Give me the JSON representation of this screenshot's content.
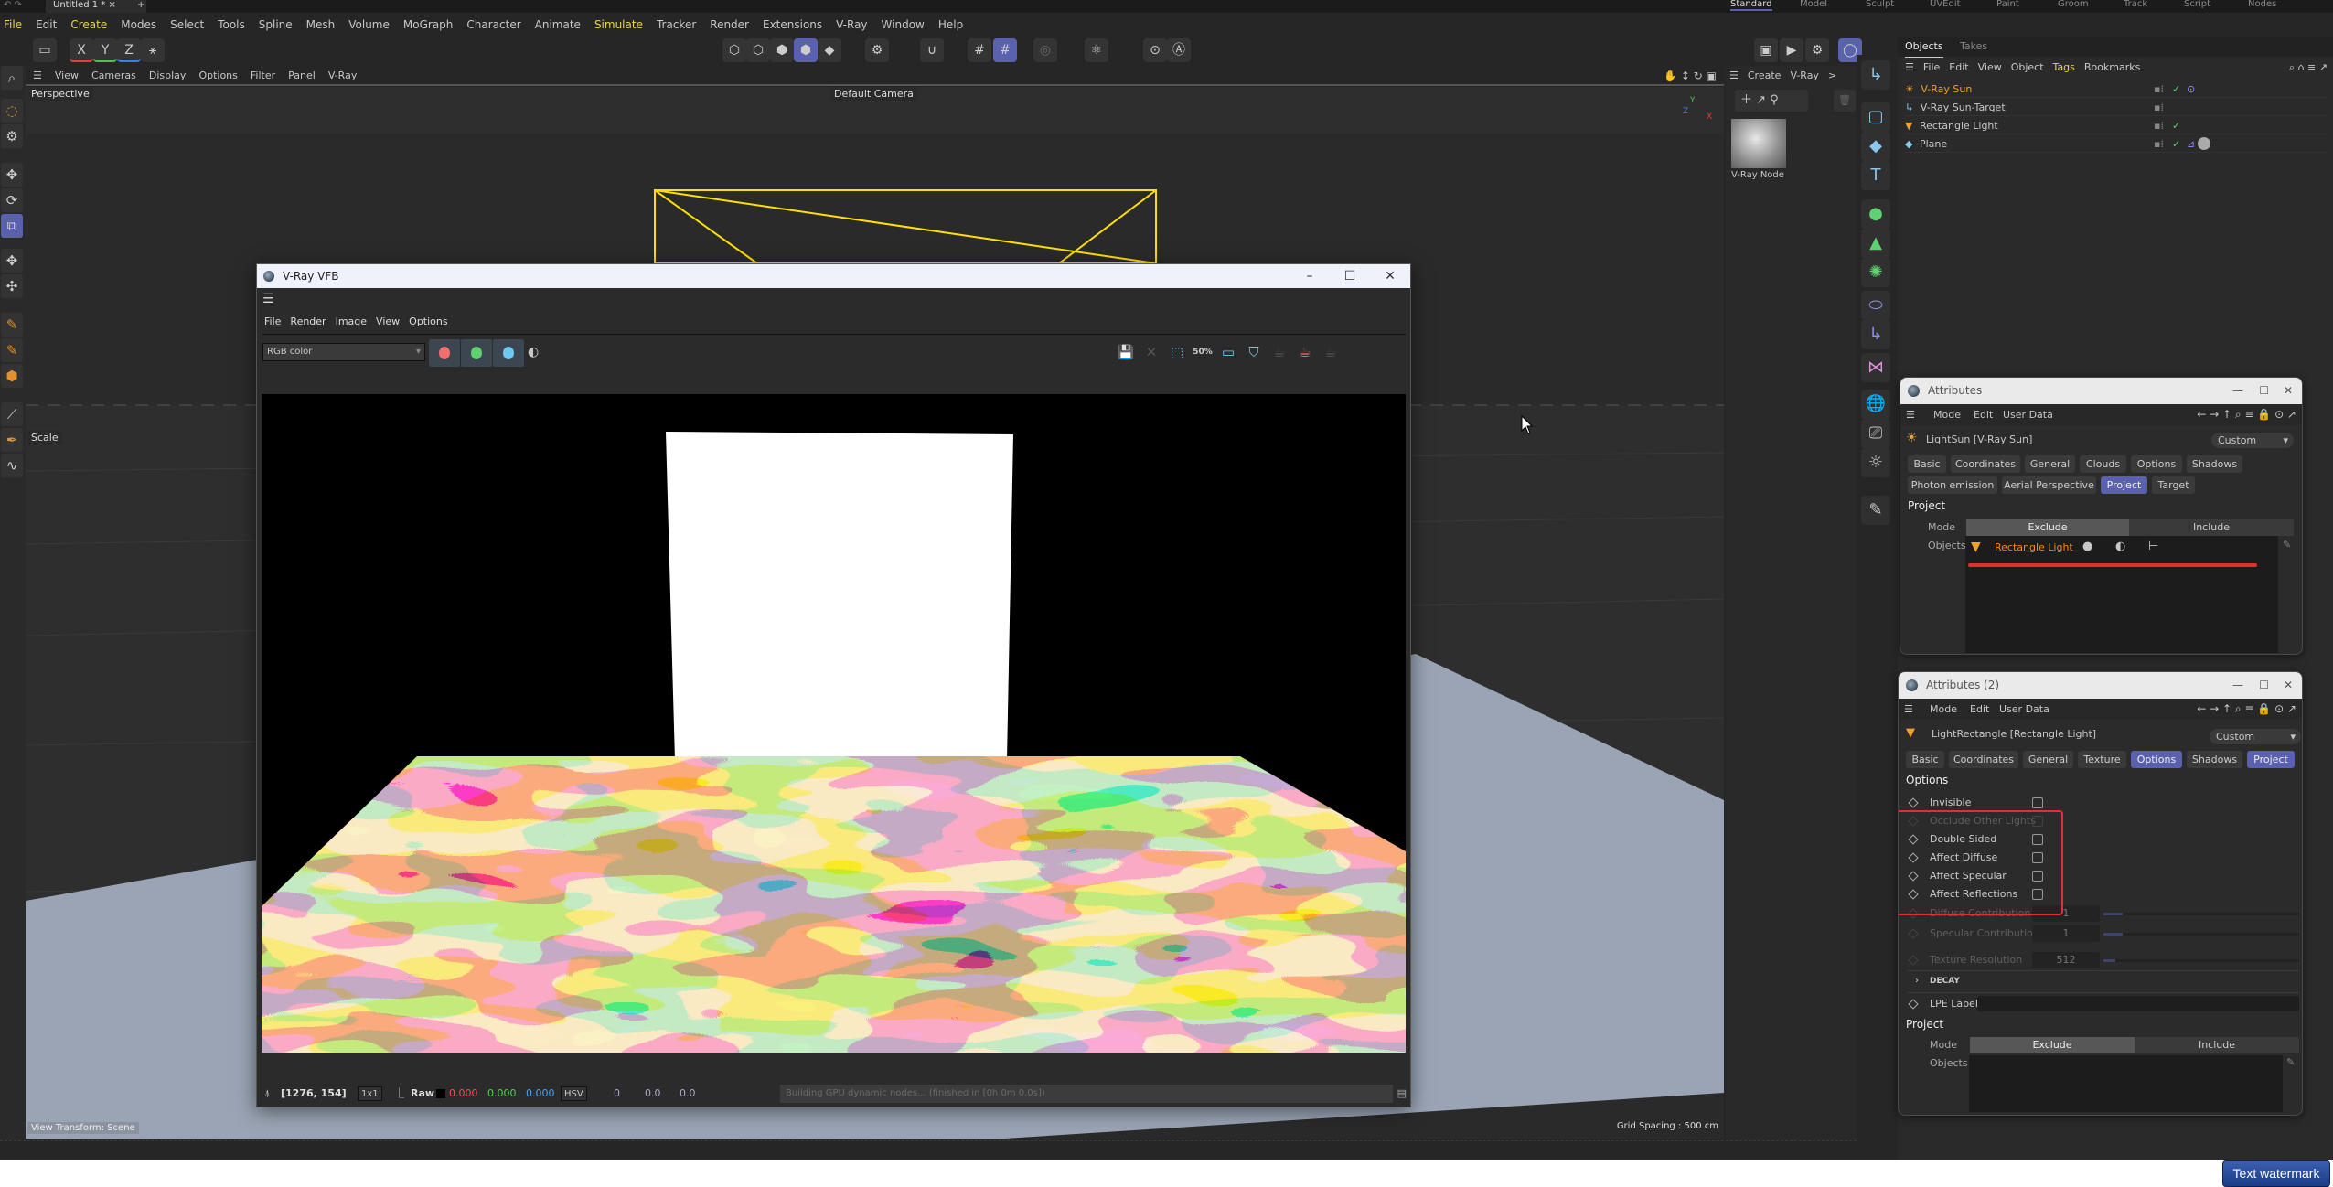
{
  "app": {
    "doc_tab": "Untitled 1 *",
    "layout_tabs": [
      "Standard",
      "Model",
      "Sculpt",
      "UVEdit",
      "Paint",
      "Groom",
      "Track",
      "Script",
      "Nodes"
    ],
    "active_layout": "Standard",
    "menu": [
      "File",
      "Edit",
      "Create",
      "Modes",
      "Select",
      "Tools",
      "Spline",
      "Mesh",
      "Volume",
      "MoGraph",
      "Character",
      "Animate",
      "Simulate",
      "Tracker",
      "Render",
      "Extensions",
      "V-Ray",
      "Window",
      "Help"
    ],
    "axis_buttons": [
      "X",
      "Y",
      "Z"
    ]
  },
  "viewport": {
    "menu": [
      "View",
      "Cameras",
      "Display",
      "Options",
      "Filter",
      "Panel",
      "V-Ray"
    ],
    "name": "Perspective",
    "camera": "Default Camera",
    "tool_label": "Scale",
    "view_transform": "View Transform: Scene",
    "grid_spacing": "Grid Spacing : 500 cm",
    "axis": {
      "y": "Y",
      "z": "Z",
      "x": "X"
    }
  },
  "vfb": {
    "title": "V-Ray VFB",
    "menu": [
      "File",
      "Render",
      "Image",
      "View",
      "Options"
    ],
    "channel": "RGB color",
    "status": {
      "coords": "[1276, 154]",
      "zoom": "1x1",
      "raw": "Raw",
      "r": "0.000",
      "g": "0.000",
      "b": "0.000",
      "color_mode": "HSV",
      "h": "0",
      "s": "0.0",
      "v": "0.0",
      "message": "Building GPU dynamic nodes... (finished in [0h  0m  0.0s])"
    },
    "zoom_icon_label": "50%",
    "colors": {
      "red": "#f07070",
      "green": "#60d070",
      "blue": "#70c8f0",
      "floor_light": "#f5d9a0",
      "floor_dark": "#1a1208"
    }
  },
  "content_browser": {
    "menu": [
      "Create",
      "V-Ray"
    ],
    "more": ">",
    "material": "V-Ray Node"
  },
  "objects": {
    "tabs": [
      "Objects",
      "Takes"
    ],
    "menu": [
      "File",
      "Edit",
      "View",
      "Object",
      "Tags",
      "Bookmarks"
    ],
    "items": [
      {
        "name": "V-Ray Sun",
        "icon": "sun-icon",
        "color": "#f0a030",
        "check": true
      },
      {
        "name": "V-Ray Sun-Target",
        "icon": "target-icon",
        "color": "#c8c8c8",
        "check": false
      },
      {
        "name": "Rectangle Light",
        "icon": "rect-light-icon",
        "color": "#c8c8c8",
        "check": true
      },
      {
        "name": "Plane",
        "icon": "plane-icon",
        "color": "#c8c8c8",
        "check": true
      }
    ]
  },
  "attributes1": {
    "title": "Attributes",
    "menu": [
      "Mode",
      "Edit",
      "User Data"
    ],
    "object": "LightSun [V-Ray Sun]",
    "preset": "Custom",
    "tabs_row1": [
      "Basic",
      "Coordinates",
      "General",
      "Clouds",
      "Options",
      "Shadows"
    ],
    "tabs_row2": [
      "Photon emission",
      "Aerial Perspective",
      "Project",
      "Target"
    ],
    "active_tab": "Project",
    "section": "Project",
    "mode_label": "Mode",
    "mode_options": [
      "Exclude",
      "Include"
    ],
    "mode_selected": "Exclude",
    "objects_label": "Objects",
    "objects_list": [
      "Rectangle Light"
    ]
  },
  "attributes2": {
    "title": "Attributes (2)",
    "menu": [
      "Mode",
      "Edit",
      "User Data"
    ],
    "object": "LightRectangle [Rectangle Light]",
    "preset": "Custom",
    "tabs": [
      "Basic",
      "Coordinates",
      "General",
      "Texture",
      "Options",
      "Shadows",
      "Project"
    ],
    "active_tabs": [
      "Options",
      "Project"
    ],
    "section": "Options",
    "options": [
      {
        "label": "Invisible",
        "checked": false,
        "enabled": true
      },
      {
        "label": "Occlude Other Lights",
        "checked": false,
        "enabled": false
      },
      {
        "label": "Double Sided",
        "checked": false,
        "enabled": true
      },
      {
        "label": "Affect Diffuse",
        "checked": false,
        "enabled": true
      },
      {
        "label": "Affect Specular",
        "checked": false,
        "enabled": true
      },
      {
        "label": "Affect Reflections",
        "checked": false,
        "enabled": true
      }
    ],
    "numeric": [
      {
        "label": "Diffuse Contribution",
        "value": "1",
        "slider": 0.1
      },
      {
        "label": "Specular Contribution",
        "value": "1",
        "slider": 0.1
      },
      {
        "label": "Texture Resolution",
        "value": "512",
        "slider": 0.06
      }
    ],
    "decay": "DECAY",
    "lpe_label": "LPE Label",
    "project_section": "Project",
    "mode_label": "Mode",
    "mode_options": [
      "Exclude",
      "Include"
    ],
    "objects_label": "Objects",
    "highlight_color": "#e03030"
  },
  "watermark": "Text watermark"
}
